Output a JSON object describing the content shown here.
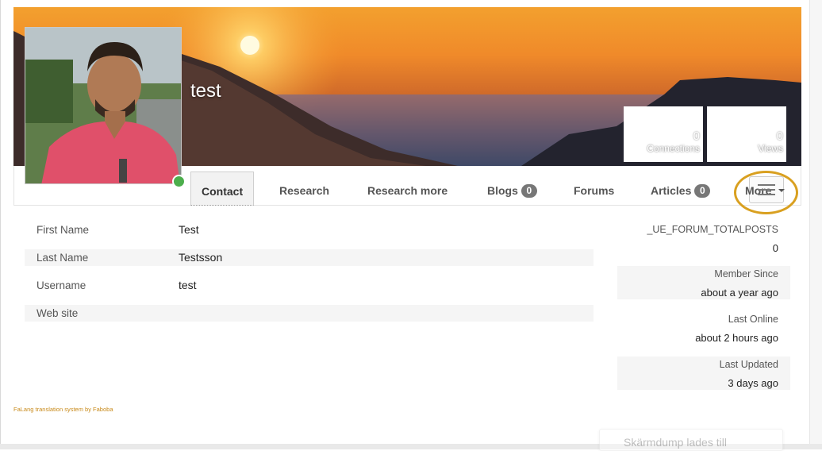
{
  "profile": {
    "name": "test",
    "stats": [
      {
        "value": "0",
        "label": "Connections"
      },
      {
        "value": "0",
        "label": "Views"
      }
    ],
    "online_status_color": "#4cae4c"
  },
  "tabs": [
    {
      "label": "Contact",
      "active": true
    },
    {
      "label": "Research"
    },
    {
      "label": "Research more"
    },
    {
      "label": "Blogs",
      "badge": "0"
    },
    {
      "label": "Forums"
    },
    {
      "label": "Articles",
      "badge": "0"
    }
  ],
  "more_menu": {
    "label": "More",
    "icon": "hamburger-icon"
  },
  "fields": [
    {
      "label": "First Name",
      "value": "Test"
    },
    {
      "label": "Last Name",
      "value": "Testsson"
    },
    {
      "label": "Username",
      "value": "test"
    },
    {
      "label": "Web site",
      "value": ""
    }
  ],
  "side": [
    {
      "title": "_UE_FORUM_TOTALPOSTS",
      "value": "0"
    },
    {
      "title": "Member Since",
      "value": "about a year ago"
    },
    {
      "title": "Last Online",
      "value": "about 2 hours ago"
    },
    {
      "title": "Last Updated",
      "value": "3 days ago"
    }
  ],
  "footer": {
    "text": "FaLang translation system by Faboba"
  },
  "toast": {
    "text": "Skärmdump lades till"
  },
  "colors": {
    "accent_ring": "#d9a020",
    "footer_link": "#c88a1a",
    "badge": "#777777"
  }
}
